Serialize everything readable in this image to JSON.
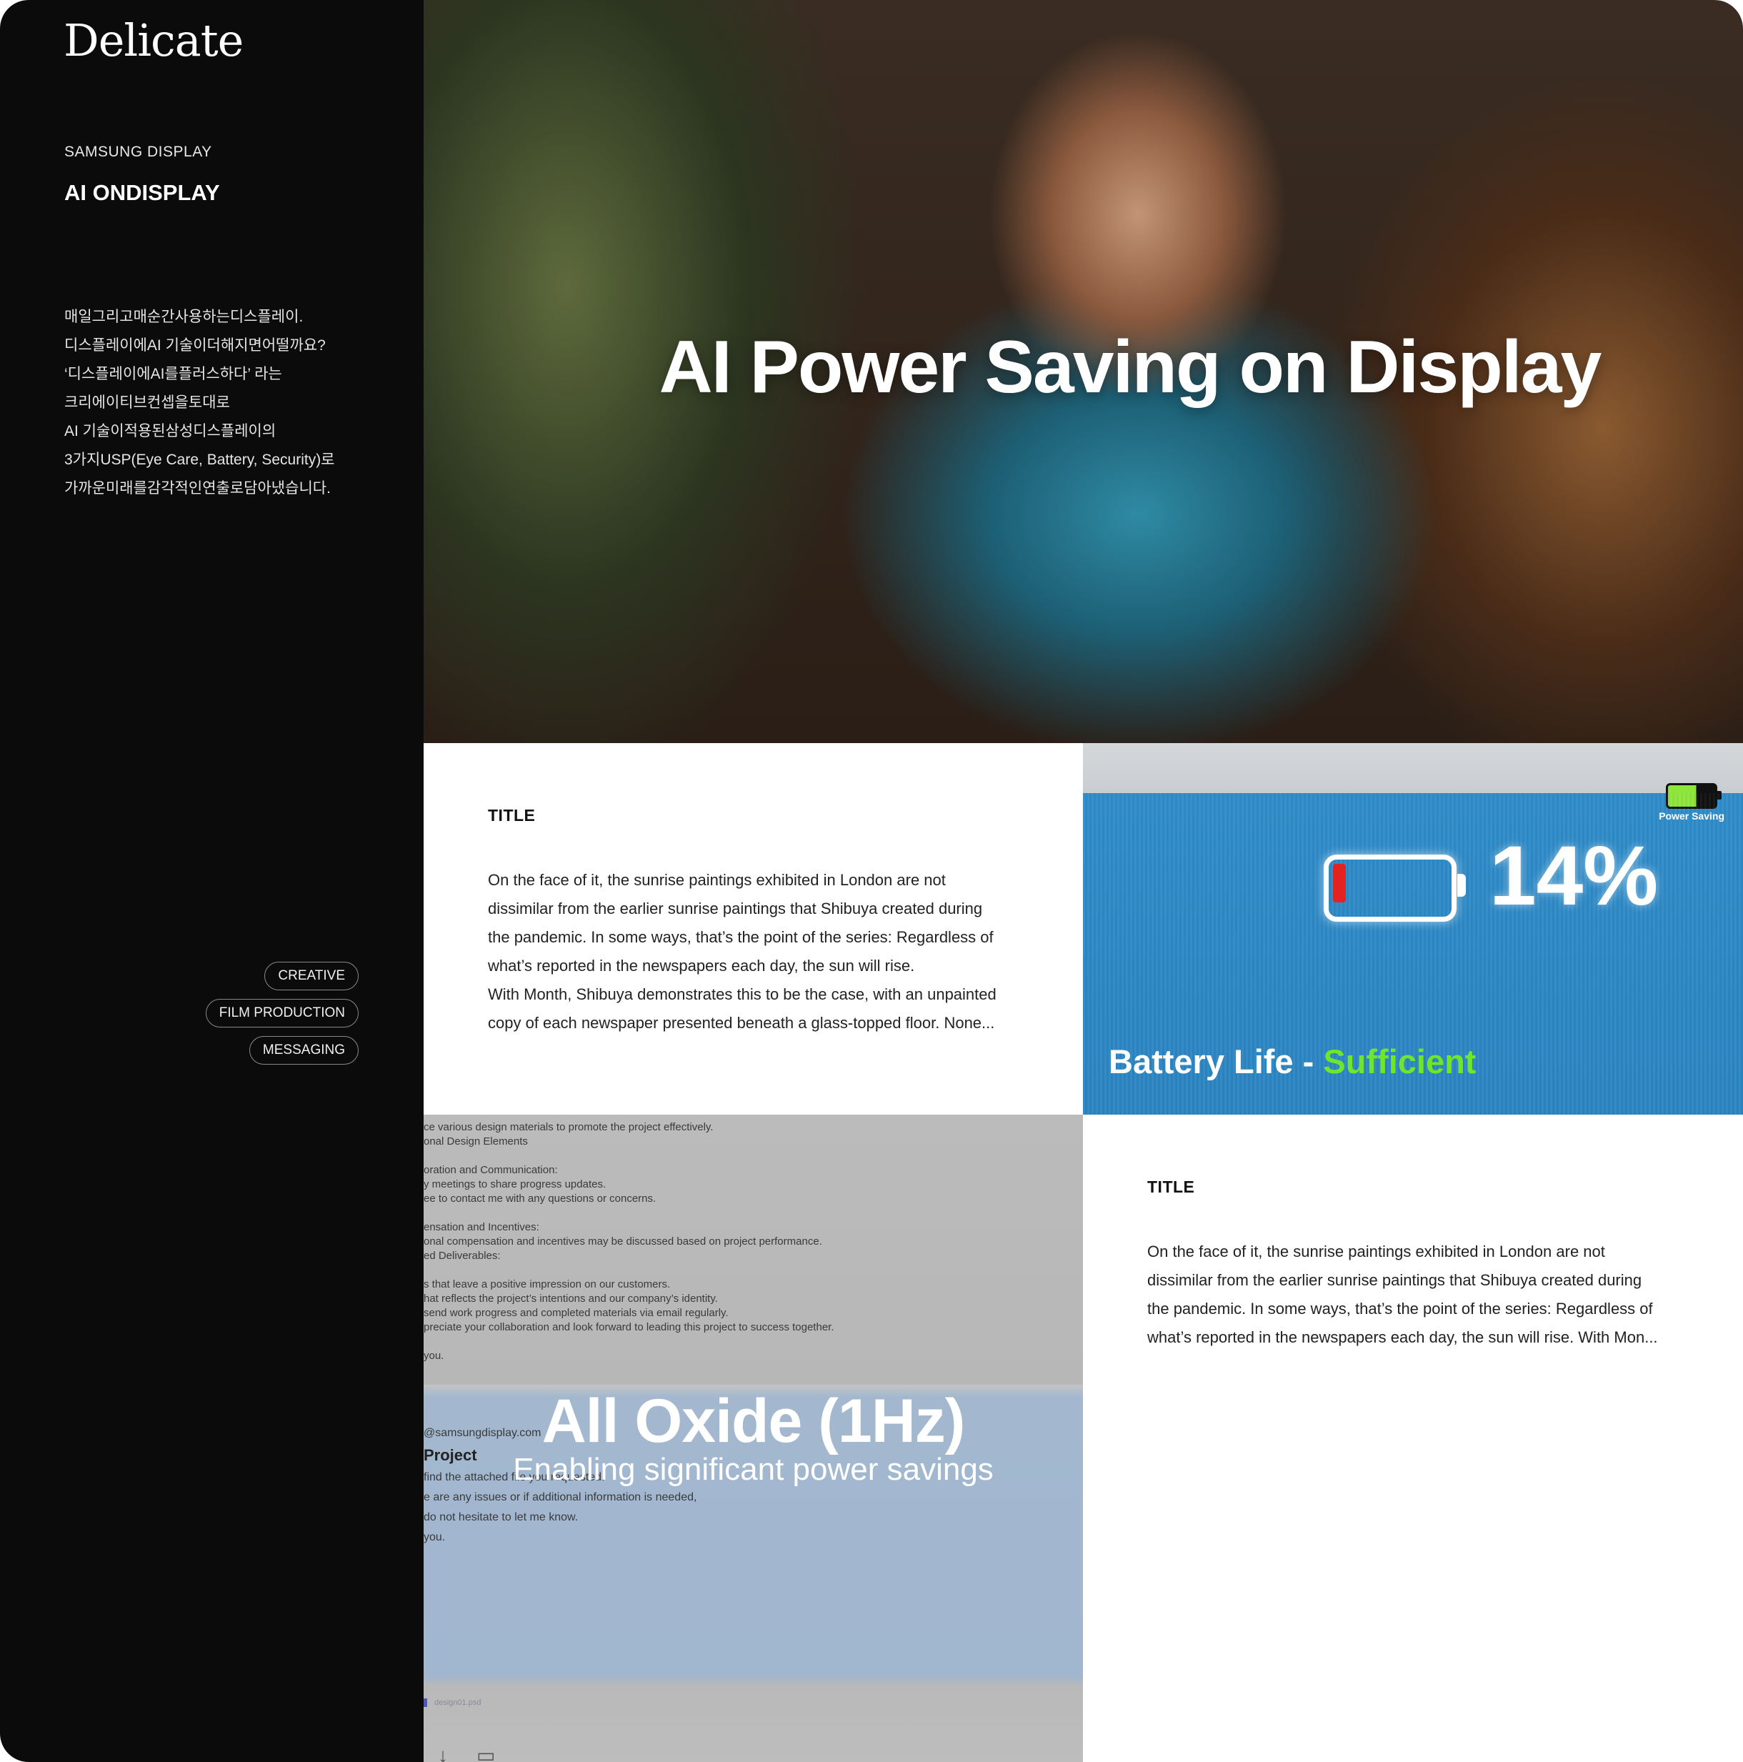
{
  "brand": {
    "logo": "Delicate"
  },
  "sidebar": {
    "client": "SAMSUNG DISPLAY",
    "project": "AI ONDISPLAY",
    "description": [
      "매일그리고매순간사용하는디스플레이.",
      "디스플레이에AI 기술이더해지면어떨까요?",
      "‘디스플레이에AI를플러스하다’ 라는",
      "크리에이티브컨셉을토대로",
      "AI 기술이적용된삼성디스플레이의",
      "3가지USP(Eye Care, Battery, Security)로",
      "가까운미래를감각적인연출로담아냈습니다."
    ],
    "tags": [
      "CREATIVE",
      "FILM PRODUCTION",
      "MESSAGING"
    ]
  },
  "hero": {
    "title": "AI Power Saving on Display"
  },
  "card1": {
    "title": "TITLE",
    "body": [
      "On the face of it, the sunrise paintings exhibited in London are not",
      "dissimilar from the earlier sunrise paintings that Shibuya created during",
      "the pandemic. In some ways, that’s the point of the series: Regardless of",
      "what’s reported in the newspapers each day, the sun will rise.",
      "With Month, Shibuya demonstrates this to be the case, with an unpainted",
      "copy of each newspaper presented beneath a glass-topped floor. None..."
    ]
  },
  "battery": {
    "badge": "Power Saving",
    "level_percent": "14%",
    "status_prefix": "Battery Life - ",
    "status_value": "Sufficient",
    "colors": {
      "panel": "#2b85c2",
      "status": "#6fe62c",
      "low": "#e32222"
    }
  },
  "oxide": {
    "doc_top": [
      "ce various design materials to promote the project effectively.",
      "onal Design Elements",
      "",
      "oration and Communication:",
      "y meetings to share progress updates.",
      "ee to contact me with any questions or concerns.",
      "",
      "ensation and Incentives:",
      "onal compensation and incentives may be discussed based on project performance.",
      "ed Deliverables:",
      "",
      "s that leave a positive impression on our customers.",
      "hat reflects the project’s intentions and our company’s identity.",
      "send work progress and completed materials via email regularly.",
      "preciate your collaboration and look forward to leading this project to success together.",
      "",
      "you."
    ],
    "email": "@samsungdisplay.com",
    "subject": "Project",
    "doc_bottom": [
      "find the attached file you requested.",
      "e are any issues or if additional information is needed,",
      "do not hesitate to let me know.",
      "you."
    ],
    "title": "All Oxide (1Hz)",
    "subtitle": "Enabling significant power savings",
    "file": "design01.psd"
  },
  "card2": {
    "title": "TITLE",
    "body": [
      "On the face of it, the sunrise paintings exhibited in London are not",
      "dissimilar from the earlier sunrise paintings that Shibuya created during",
      "the pandemic. In some ways, that’s the point of the series: Regardless of",
      "what’s reported in the newspapers each day, the sun will rise. With Mon..."
    ]
  }
}
